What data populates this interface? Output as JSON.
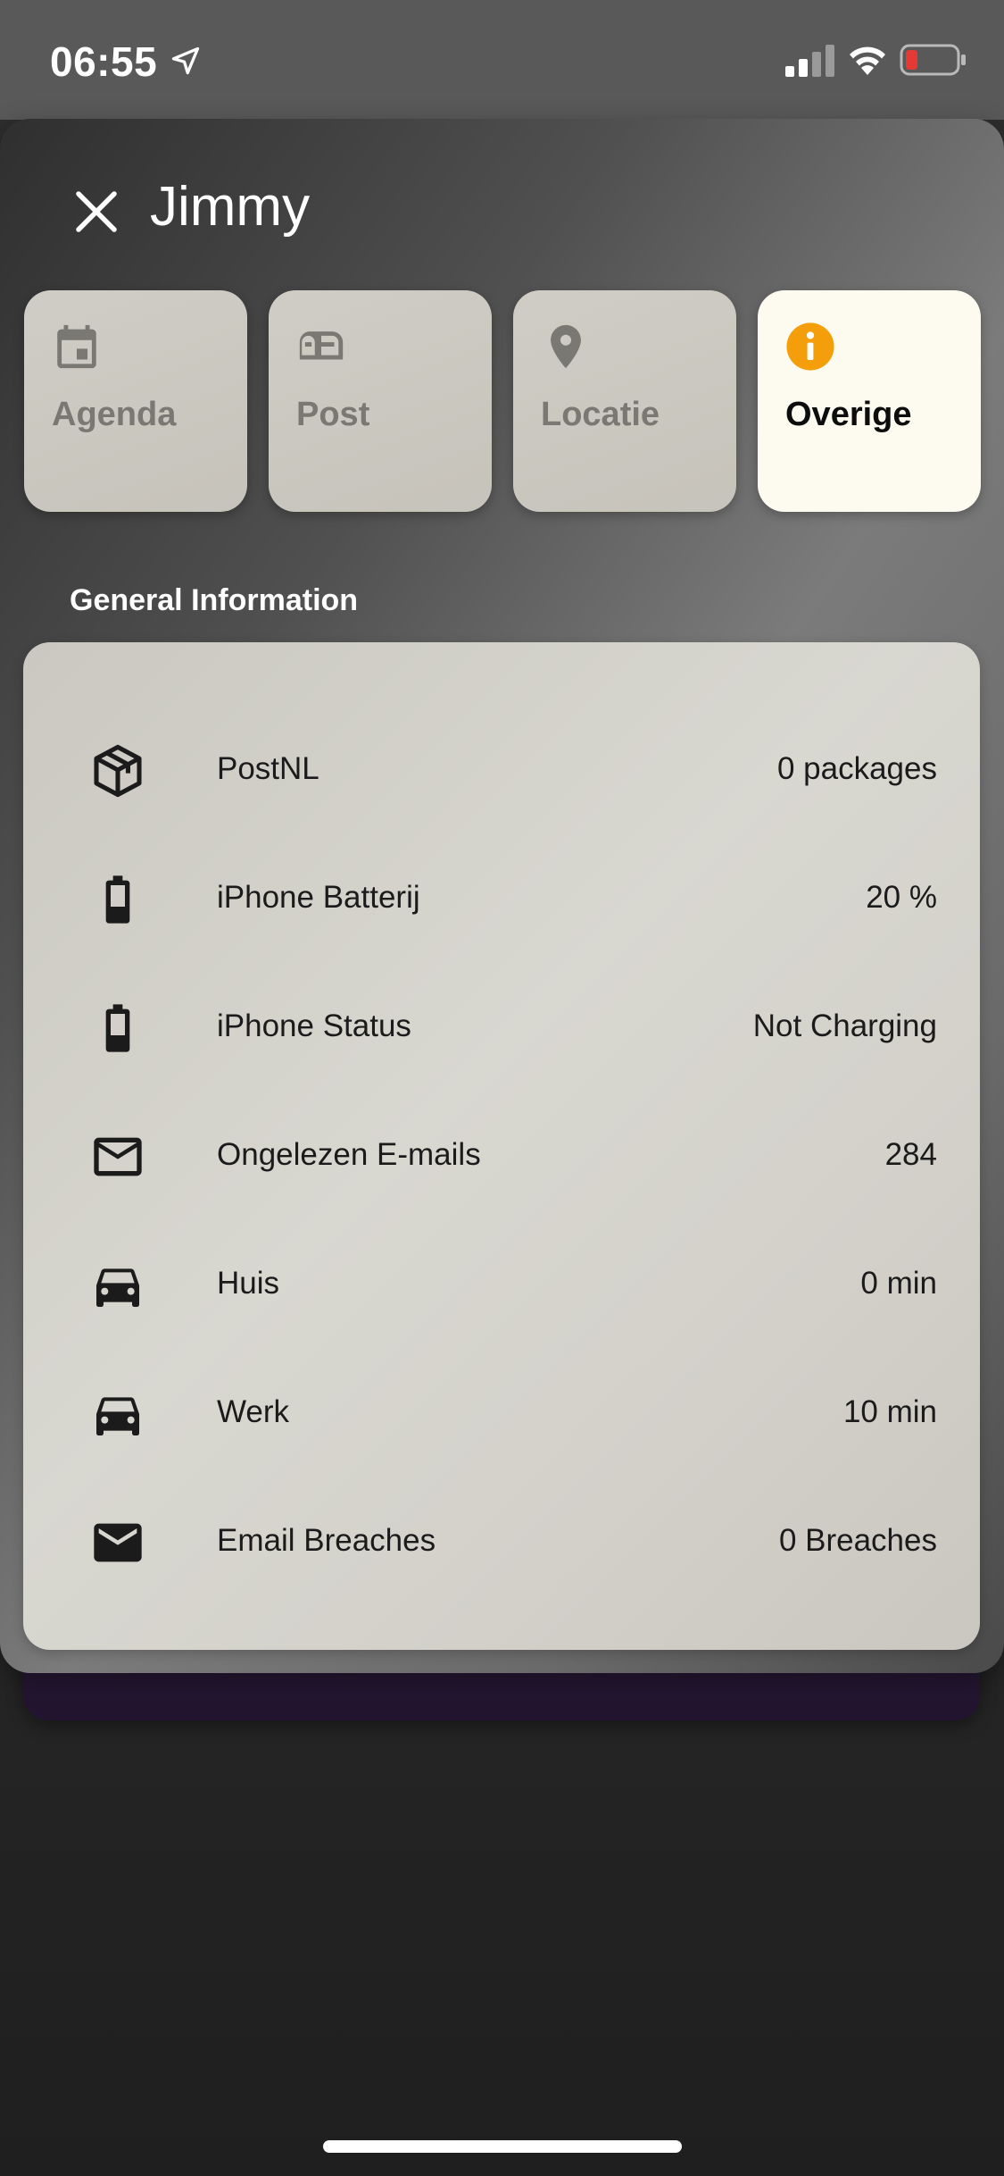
{
  "status_bar": {
    "time": "06:55",
    "battery_color": "#e53935"
  },
  "header": {
    "title": "Jimmy"
  },
  "tabs": [
    {
      "label": "Agenda",
      "icon": "calendar-icon",
      "active": false
    },
    {
      "label": "Post",
      "icon": "mailbox-icon",
      "active": false
    },
    {
      "label": "Locatie",
      "icon": "map-pin-icon",
      "active": false
    },
    {
      "label": "Overige",
      "icon": "info-icon",
      "active": true
    }
  ],
  "section": {
    "title": "General Information"
  },
  "rows": [
    {
      "label": "PostNL",
      "value": "0 packages",
      "icon": "package-icon"
    },
    {
      "label": "iPhone Batterij",
      "value": "20 %",
      "icon": "battery-icon"
    },
    {
      "label": "iPhone Status",
      "value": "Not Charging",
      "icon": "battery-icon"
    },
    {
      "label": "Ongelezen E-mails",
      "value": "284",
      "icon": "mail-outline-icon"
    },
    {
      "label": "Huis",
      "value": "0 min",
      "icon": "car-icon"
    },
    {
      "label": "Werk",
      "value": "10 min",
      "icon": "car-icon"
    },
    {
      "label": "Email Breaches",
      "value": "0 Breaches",
      "icon": "mail-filled-icon"
    }
  ],
  "colors": {
    "accent": "#f59e0b",
    "tab_active_bg": "#fdfbf0",
    "tab_bg": "#cac8c0",
    "card_bg": "#d4d2cb"
  }
}
